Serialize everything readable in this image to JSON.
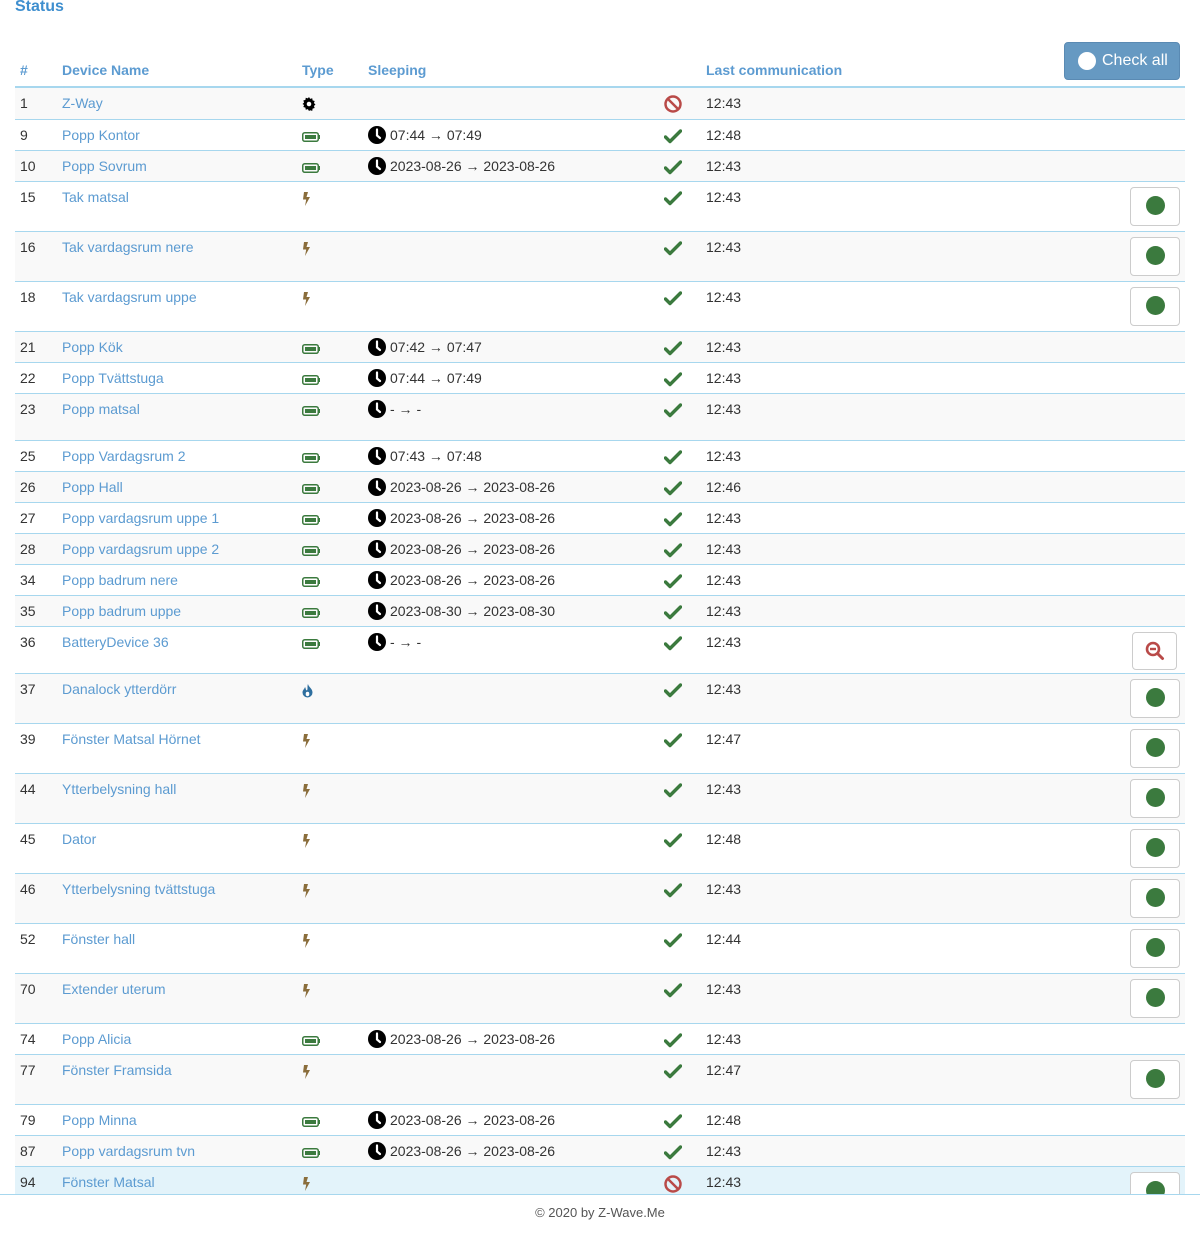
{
  "title": "Status",
  "check_all_label": "Check all",
  "columns": {
    "num": "#",
    "name": "Device Name",
    "type": "Type",
    "sleeping": "Sleeping",
    "last": "Last communication"
  },
  "colors": {
    "accent": "#5c9bd1",
    "ok": "#3b7a3e",
    "failed": "#b94a48",
    "battery": "#3b7a3e",
    "mains": "#8a6d3b",
    "flirs": "#2f6f9f"
  },
  "devices": [
    {
      "id": "1",
      "name": "Z-Way",
      "type": "controller",
      "sleep": "",
      "status": "failed",
      "last": "12:43",
      "action": ""
    },
    {
      "id": "9",
      "name": "Popp Kontor",
      "type": "battery",
      "sleep": "07:44 → 07:49",
      "status": "ok",
      "last": "12:48",
      "action": ""
    },
    {
      "id": "10",
      "name": "Popp Sovrum",
      "type": "battery",
      "sleep": "2023-08-26 → 2023-08-26",
      "status": "ok",
      "last": "12:43",
      "action": ""
    },
    {
      "id": "15",
      "name": "Tak matsal",
      "type": "mains",
      "sleep": "",
      "status": "ok",
      "last": "12:43",
      "action": "ping"
    },
    {
      "id": "16",
      "name": "Tak vardagsrum nere",
      "type": "mains",
      "sleep": "",
      "status": "ok",
      "last": "12:43",
      "action": "ping"
    },
    {
      "id": "18",
      "name": "Tak vardagsrum uppe",
      "type": "mains",
      "sleep": "",
      "status": "ok",
      "last": "12:43",
      "action": "ping"
    },
    {
      "id": "21",
      "name": "Popp Kök",
      "type": "battery",
      "sleep": "07:42 → 07:47",
      "status": "ok",
      "last": "12:43",
      "action": ""
    },
    {
      "id": "22",
      "name": "Popp Tvättstuga",
      "type": "battery",
      "sleep": "07:44 → 07:49",
      "status": "ok",
      "last": "12:43",
      "action": ""
    },
    {
      "id": "23",
      "name": "Popp matsal",
      "type": "battery",
      "sleep": "- → -",
      "status": "ok",
      "last": "12:43",
      "action": "interview"
    },
    {
      "id": "25",
      "name": "Popp Vardagsrum 2",
      "type": "battery",
      "sleep": "07:43 → 07:48",
      "status": "ok",
      "last": "12:43",
      "action": ""
    },
    {
      "id": "26",
      "name": "Popp Hall",
      "type": "battery",
      "sleep": "2023-08-26 → 2023-08-26",
      "status": "ok",
      "last": "12:46",
      "action": ""
    },
    {
      "id": "27",
      "name": "Popp vardagsrum uppe 1",
      "type": "battery",
      "sleep": "2023-08-26 → 2023-08-26",
      "status": "ok",
      "last": "12:43",
      "action": ""
    },
    {
      "id": "28",
      "name": "Popp vardagsrum uppe 2",
      "type": "battery",
      "sleep": "2023-08-26 → 2023-08-26",
      "status": "ok",
      "last": "12:43",
      "action": ""
    },
    {
      "id": "34",
      "name": "Popp badrum nere",
      "type": "battery",
      "sleep": "2023-08-26 → 2023-08-26",
      "status": "ok",
      "last": "12:43",
      "action": ""
    },
    {
      "id": "35",
      "name": "Popp badrum uppe",
      "type": "battery",
      "sleep": "2023-08-30 → 2023-08-30",
      "status": "ok",
      "last": "12:43",
      "action": ""
    },
    {
      "id": "36",
      "name": "BatteryDevice 36",
      "type": "battery",
      "sleep": "- → -",
      "status": "ok",
      "last": "12:43",
      "action": "interview"
    },
    {
      "id": "37",
      "name": "Danalock ytterdörr",
      "type": "flirs",
      "sleep": "",
      "status": "ok",
      "last": "12:43",
      "action": "ping"
    },
    {
      "id": "39",
      "name": "Fönster Matsal Hörnet",
      "type": "mains",
      "sleep": "",
      "status": "ok",
      "last": "12:47",
      "action": "ping"
    },
    {
      "id": "44",
      "name": "Ytterbelysning hall",
      "type": "mains",
      "sleep": "",
      "status": "ok",
      "last": "12:43",
      "action": "ping"
    },
    {
      "id": "45",
      "name": "Dator",
      "type": "mains",
      "sleep": "",
      "status": "ok",
      "last": "12:48",
      "action": "ping"
    },
    {
      "id": "46",
      "name": "Ytterbelysning tvättstuga",
      "type": "mains",
      "sleep": "",
      "status": "ok",
      "last": "12:43",
      "action": "ping"
    },
    {
      "id": "52",
      "name": "Fönster hall",
      "type": "mains",
      "sleep": "",
      "status": "ok",
      "last": "12:44",
      "action": "ping"
    },
    {
      "id": "70",
      "name": "Extender uterum",
      "type": "mains",
      "sleep": "",
      "status": "ok",
      "last": "12:43",
      "action": "ping"
    },
    {
      "id": "74",
      "name": "Popp Alicia",
      "type": "battery",
      "sleep": "2023-08-26 → 2023-08-26",
      "status": "ok",
      "last": "12:43",
      "action": ""
    },
    {
      "id": "77",
      "name": "Fönster Framsida",
      "type": "mains",
      "sleep": "",
      "status": "ok",
      "last": "12:47",
      "action": "ping"
    },
    {
      "id": "79",
      "name": "Popp Minna",
      "type": "battery",
      "sleep": "2023-08-26 → 2023-08-26",
      "status": "ok",
      "last": "12:48",
      "action": ""
    },
    {
      "id": "87",
      "name": "Popp vardagsrum tvn",
      "type": "battery",
      "sleep": "2023-08-26 → 2023-08-26",
      "status": "ok",
      "last": "12:43",
      "action": ""
    },
    {
      "id": "94",
      "name": "Fönster Matsal",
      "type": "mains",
      "sleep": "",
      "status": "failed",
      "last": "12:43",
      "action": "ping",
      "hover": true
    }
  ],
  "footer": "© 2020 by Z-Wave.Me"
}
